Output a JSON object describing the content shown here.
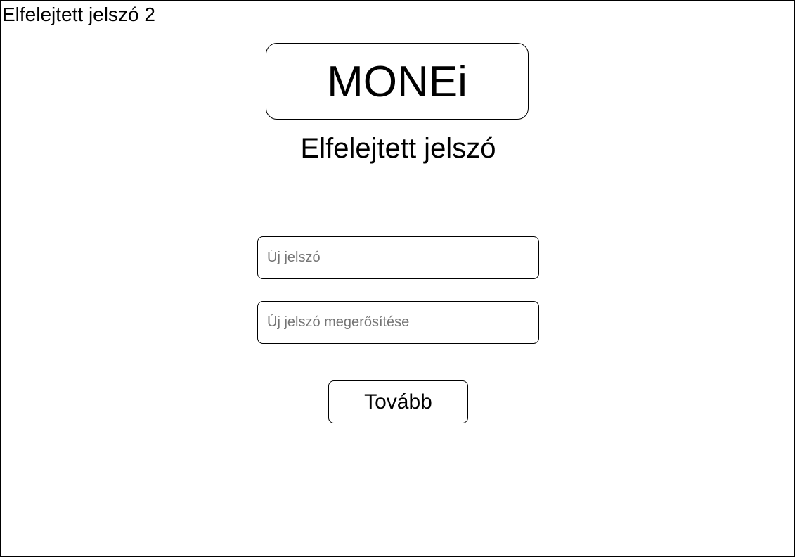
{
  "screen": {
    "label": "Elfelejtett jelszó 2"
  },
  "logo": {
    "text": "MONEi"
  },
  "page": {
    "title": "Elfelejtett jelszó"
  },
  "form": {
    "new_password": {
      "value": "",
      "placeholder": "Új jelszó"
    },
    "confirm_password": {
      "value": "",
      "placeholder": "Új jelszó megerősítése"
    },
    "submit_label": "Tovább"
  }
}
